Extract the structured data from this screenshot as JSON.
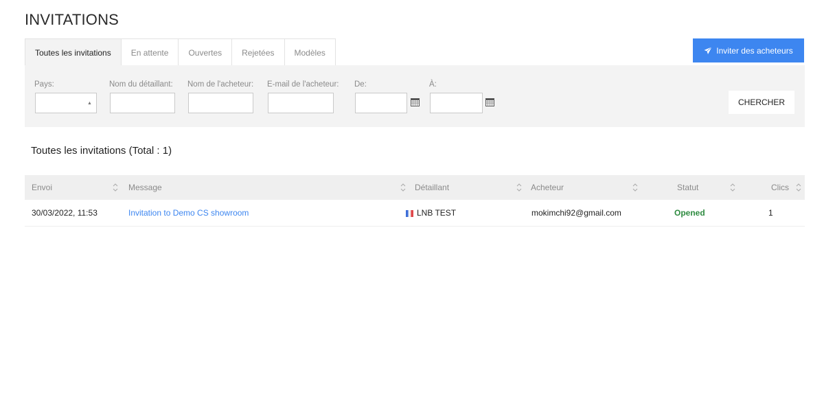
{
  "page": {
    "title": "INVITATIONS"
  },
  "tabs": [
    {
      "label": "Toutes les invitations",
      "active": true
    },
    {
      "label": "En attente",
      "active": false
    },
    {
      "label": "Ouvertes",
      "active": false
    },
    {
      "label": "Rejetées",
      "active": false
    },
    {
      "label": "Modèles",
      "active": false
    }
  ],
  "invite_button": {
    "label": "Inviter des acheteurs",
    "icon": "send-icon"
  },
  "filters": {
    "country": {
      "label": "Pays:",
      "value": ""
    },
    "retailer_name": {
      "label": "Nom du détaillant:",
      "value": ""
    },
    "buyer_name": {
      "label": "Nom de l'acheteur:",
      "value": ""
    },
    "buyer_email": {
      "label": "E-mail de l'acheteur:",
      "value": ""
    },
    "from": {
      "label": "De:",
      "value": ""
    },
    "to": {
      "label": "À:",
      "value": ""
    },
    "search_label": "CHERCHER"
  },
  "list": {
    "title": "Toutes les invitations (Total : 1)",
    "columns": [
      "Envoi",
      "Message",
      "Détaillant",
      "Acheteur",
      "Statut",
      "Clics"
    ],
    "rows": [
      {
        "sent": "30/03/2022, 11:53",
        "message": "Invitation to Demo CS showroom",
        "retailer": "LNB TEST",
        "retailer_flag": "france-flag-icon",
        "buyer": "mokimchi92@gmail.com",
        "status": "Opened",
        "clicks": "1"
      }
    ]
  },
  "colors": {
    "accent": "#3d86f0",
    "status_opened": "#2e8b40",
    "panel_bg": "#f3f3f3"
  }
}
